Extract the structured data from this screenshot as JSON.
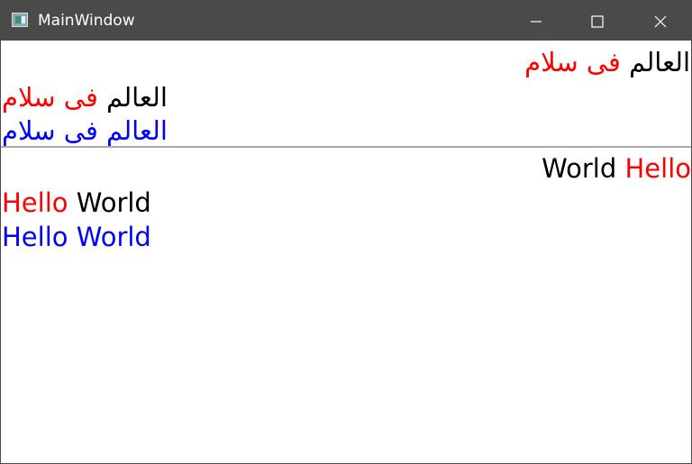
{
  "window": {
    "title": "MainWindow",
    "controls": [
      "minimize-icon",
      "maximize-icon",
      "close-icon"
    ]
  },
  "top_panel": {
    "line1": {
      "red": "فی سلام",
      "black": "العالم"
    },
    "line2": {
      "red": "فی سلام",
      "black": "العالم"
    },
    "line3": {
      "blue": "العالم فی سلام"
    }
  },
  "bottom_panel": {
    "line1": {
      "black": "World",
      "red": "Hello"
    },
    "line2": {
      "red": "Hello",
      "black": "World"
    },
    "line3": {
      "blue": "Hello World"
    }
  },
  "colors": {
    "titlebar": "#4a4a48",
    "red": "#ff0000",
    "blue": "#0000ff",
    "divider": "#a9a9a9"
  }
}
